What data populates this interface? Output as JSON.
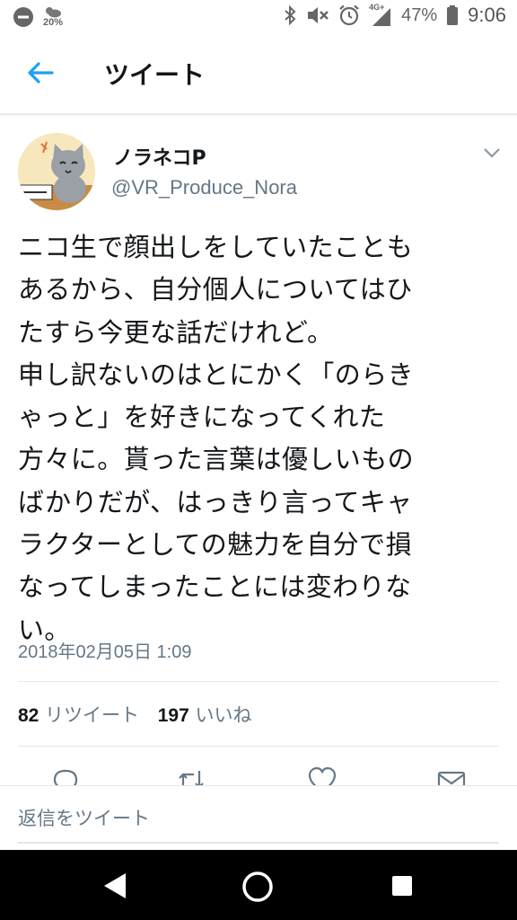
{
  "status_bar": {
    "weather_percent": "20%",
    "network_label": "4G+",
    "battery_percent": "47%",
    "time": "9:06",
    "icons": [
      "do-not-disturb-icon",
      "weather-icon",
      "bluetooth-icon",
      "mute-icon",
      "alarm-icon",
      "signal-icon",
      "battery-icon"
    ]
  },
  "header": {
    "title": "ツイート",
    "back_icon": "back-arrow-icon",
    "accent_color": "#1da1f2"
  },
  "tweet": {
    "author_name": "ノラネコP",
    "author_handle": "@VR_Produce_Nora",
    "avatar": "avatar-cat-image",
    "text_lines": [
      "ニコ生で顔出しをしていたことも",
      "あるから、自分個人についてはひ",
      "たすら今更な話だけれど。",
      "申し訳ないのはとにかく「のらき",
      "ゃっと」を好きになってくれた",
      "方々に。貰った言葉は優しいもの",
      "ばかりだが、はっきり言ってキャ",
      "ラクターとしての魅力を自分で損",
      "なってしまったことには変わりな",
      "い。"
    ],
    "timestamp": "2018年02月05日 1:09",
    "retweet_count": "82",
    "retweet_label": "リツイート",
    "like_count": "197",
    "like_label": "いいね"
  },
  "actions": [
    "reply-icon",
    "retweet-icon",
    "like-icon",
    "share-icon"
  ],
  "reply": {
    "placeholder": "返信をツイート"
  },
  "nav": [
    "back-triangle-icon",
    "home-circle-icon",
    "recents-square-icon"
  ]
}
